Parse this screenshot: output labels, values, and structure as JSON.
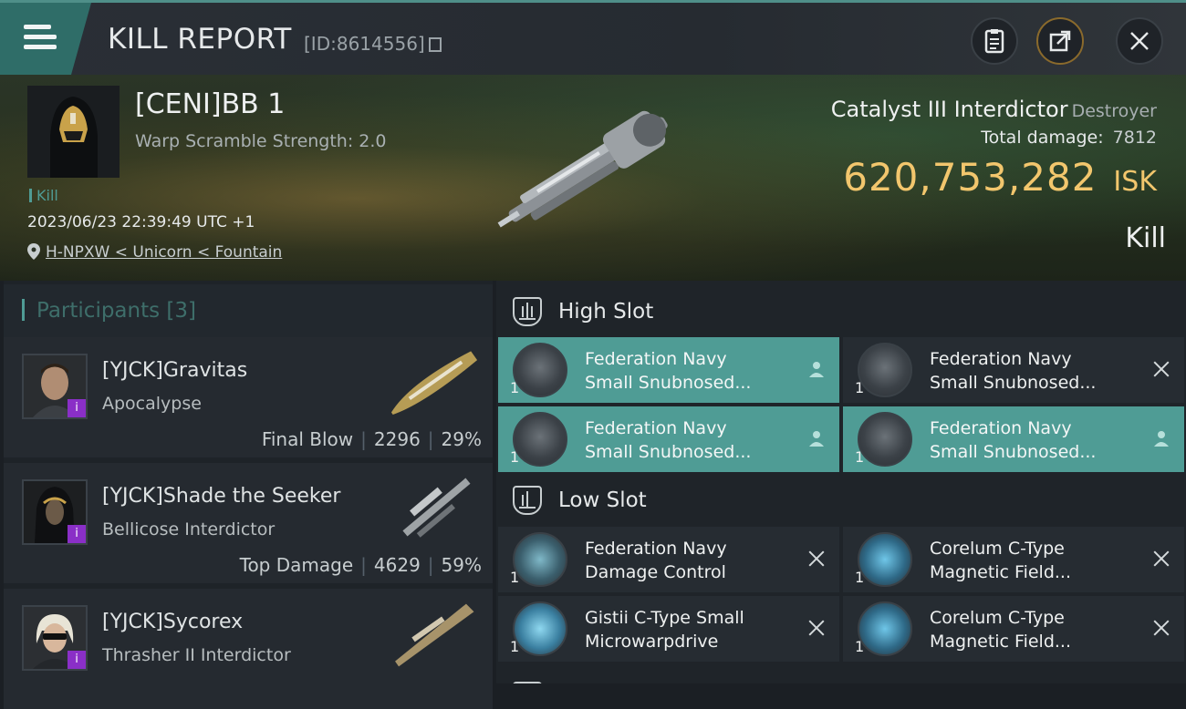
{
  "header": {
    "title": "KILL REPORT",
    "kill_id": "[ID:8614556]",
    "icons": [
      "menu-icon",
      "clipboard-icon",
      "share-icon",
      "close-icon"
    ]
  },
  "victim": {
    "pilot_name": "[CENI]BB 1",
    "warp_scramble": "Warp Scramble Strength: 2.0",
    "tag": "Kill",
    "datetime": "2023/06/23 22:39:49 UTC +1",
    "location": "H-NPXW < Unicorn < Fountain",
    "ship_name": "Catalyst III Interdictor",
    "ship_class": "Destroyer",
    "total_damage_label": "Total damage:",
    "total_damage": "7812",
    "isk_value": "620,753,282",
    "isk_unit": "ISK",
    "result": "Kill"
  },
  "participants": {
    "title": "Participants",
    "count": "[3]",
    "items": [
      {
        "name": "[YJCK]Gravitas",
        "ship": "Apocalypse",
        "role": "Final Blow",
        "damage": "2296",
        "percent": "29%"
      },
      {
        "name": "[YJCK]Shade the Seeker",
        "ship": "Bellicose Interdictor",
        "role": "Top Damage",
        "damage": "4629",
        "percent": "59%"
      },
      {
        "name": "[YJCK]Sycorex",
        "ship": "Thrasher II Interdictor",
        "role": "",
        "damage": "",
        "percent": ""
      }
    ]
  },
  "high_slot": {
    "title": "High Slot",
    "modules": [
      {
        "line1": "Federation Navy",
        "line2": "Small Snubnosed...",
        "qty": "1",
        "status": "fitted"
      },
      {
        "line1": "Federation Navy",
        "line2": "Small Snubnosed...",
        "qty": "1",
        "status": "destroyed"
      },
      {
        "line1": "Federation Navy",
        "line2": "Small Snubnosed...",
        "qty": "1",
        "status": "fitted"
      },
      {
        "line1": "Federation Navy",
        "line2": "Small Snubnosed...",
        "qty": "1",
        "status": "fitted"
      }
    ]
  },
  "low_slot": {
    "title": "Low Slot",
    "modules": [
      {
        "line1": "Federation Navy",
        "line2": "Damage Control",
        "qty": "1",
        "status": "destroyed"
      },
      {
        "line1": "Corelum C-Type",
        "line2": "Magnetic Field...",
        "qty": "1",
        "status": "destroyed"
      },
      {
        "line1": "Gistii C-Type Small",
        "line2": "Microwarpdrive",
        "qty": "1",
        "status": "destroyed"
      },
      {
        "line1": "Corelum C-Type",
        "line2": "Magnetic Field...",
        "qty": "1",
        "status": "destroyed"
      }
    ]
  },
  "colors": {
    "accent_teal": "#4f9c95",
    "isk_gold": "#f2c66d",
    "badge_purple": "#8a2fc7"
  }
}
